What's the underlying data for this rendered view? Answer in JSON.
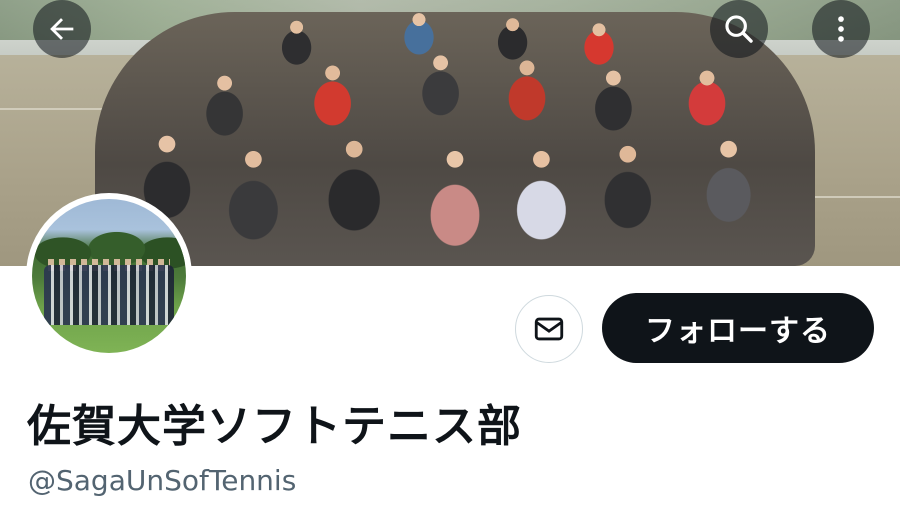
{
  "header": {
    "back_icon": "arrow-left-icon",
    "search_icon": "search-icon",
    "more_icon": "more-vertical-icon",
    "overlay_color": "#0f1419"
  },
  "profile": {
    "display_name": "佐賀大学ソフトテニス部",
    "handle": "@SagaUnSofTennis"
  },
  "actions": {
    "message_icon": "mail-icon",
    "follow_label": "フォローする",
    "follow_bg": "#0f1419",
    "follow_text_color": "#ffffff"
  },
  "colors": {
    "text_primary": "#0f1419",
    "text_secondary": "#536471",
    "border": "#cfd9de"
  }
}
